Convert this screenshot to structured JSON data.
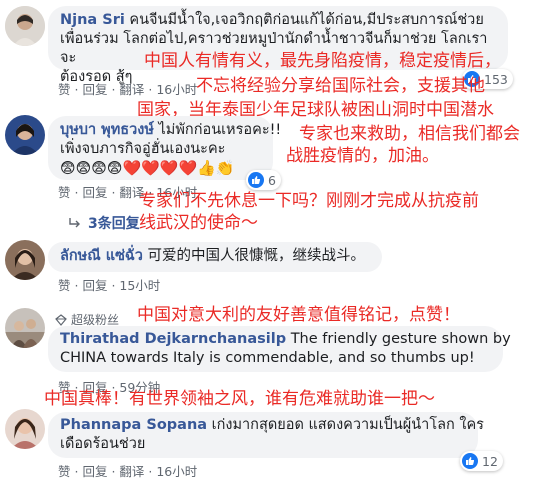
{
  "comments": [
    {
      "name": "Njna Sri",
      "text_rest": " คนจีนมีน้ำใจ,เจอวิกฤติก่อนแก้ได้ก่อน,มีประสบการณ์ช่วย",
      "line2": "เพื่อนร่วม โลกต่อไป,คราวช่วยหมูป่านักดำน้ำชาวจีนก็มาช่วย โลกเราจะ",
      "line3": "ต้องรอด สู้ๆ",
      "overlay1": "中国人有情有义，最先身陷疫情，稳定疫情后，",
      "overlay2": "不忘将经验分享给国际社会，支援其他",
      "overlay3": "国家，当年泰国少年足球队被困山洞时中国潜水",
      "like": "赞",
      "reply": "回复",
      "more": "翻译",
      "time": "16小时",
      "react_count": "153"
    },
    {
      "name": "บุษบา พุทธวงษ์",
      "text_rest": " ไม่พักก่อนเหรอคะ!!",
      "line2": "เพิ่งจบภารกิจอู่ฮั่นเองนะคะ",
      "emoji_line": "😨😨😨😨❤️❤️❤️❤️👍👏",
      "overlay1": "专家也来救助，相信我们都会",
      "overlay2": "战胜疫情的，加油。",
      "overlay3": "专家们不先休息一下吗？刚刚才完成从抗疫前",
      "overlay4": "线武汉的使命～",
      "like": "赞",
      "reply": "回复",
      "more": "翻译",
      "time": "16小时",
      "react_count": "6",
      "replies_label": "3条回复"
    },
    {
      "name": "ลักษณี แซ่ฉั่ว",
      "text": " 可爱的中国人很慷慨，继续战斗。",
      "like": "赞",
      "reply": "回复",
      "time": "15小时"
    },
    {
      "badge": "超级粉丝",
      "name": "Thirathad Dejkarnchanasilp",
      "line1": "The friendly gesture shown by",
      "line2": "CHINA towards Italy is commendable, and so thumbs up!",
      "overlay1": "中国对意大利的友好善意值得铭记，点赞！",
      "like": "赞",
      "reply": "回复",
      "time": "59分钟"
    },
    {
      "name": "Phannapa Sopana",
      "text_rest": " เก่งมากสุดยอด แสดงความเป็นผู้นำโลก ใคร",
      "line2": "เดือดร้อนช่วย",
      "overlay1": "中国真棒！有世界领袖之风，谁有危难就助谁一把～",
      "like": "赞",
      "reply": "回复",
      "more": "翻译",
      "time": "16小时",
      "react_count": "12"
    }
  ],
  "colors": {
    "overlay_red": "#ea2a26",
    "name_blue": "#385898",
    "bubble_gray": "#f2f3f5",
    "like_blue": "#1877f2"
  }
}
